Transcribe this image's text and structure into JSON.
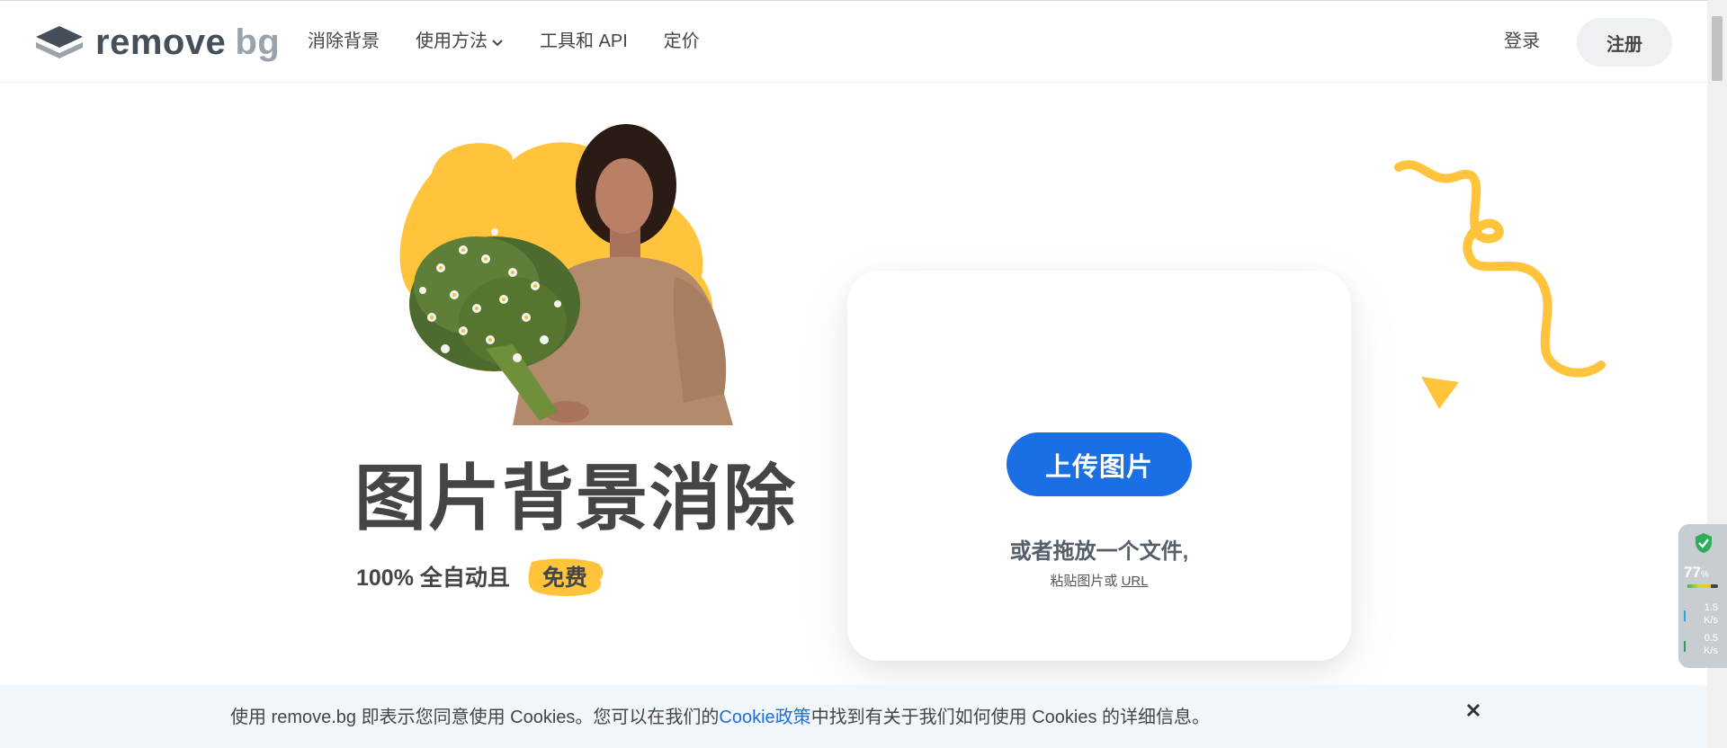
{
  "brand": {
    "name_part1": "remove",
    "name_part2": "bg"
  },
  "nav": {
    "items": [
      {
        "label": "消除背景"
      },
      {
        "label": "使用方法"
      },
      {
        "label": "工具和 API"
      },
      {
        "label": "定价"
      }
    ],
    "login_label": "登录",
    "signup_label": "注册"
  },
  "hero": {
    "title": "图片背景消除",
    "subtitle_prefix": "100% 全自动且",
    "subtitle_badge": "免费"
  },
  "upload": {
    "button_label": "上传图片",
    "drop_text": "或者拖放一个文件,",
    "paste_prefix": "粘贴图片或 ",
    "paste_link": "URL"
  },
  "cookie": {
    "text_before": "使用 remove.bg 即表示您同意使用 Cookies。您可以在我们的",
    "link_text": "Cookie政策",
    "text_after": "中找到有关于我们如何使用 Cookies 的详细信息。"
  },
  "widget": {
    "percent": "77",
    "percent_unit": "%",
    "upload_speed": "1.5",
    "upload_unit": "K/s",
    "download_speed": "0.5",
    "download_unit": "K/s",
    "level": 0.77
  },
  "colors": {
    "accent_blue": "#1b6fe4",
    "accent_yellow": "#ffc43b",
    "text_dark": "#454545"
  }
}
